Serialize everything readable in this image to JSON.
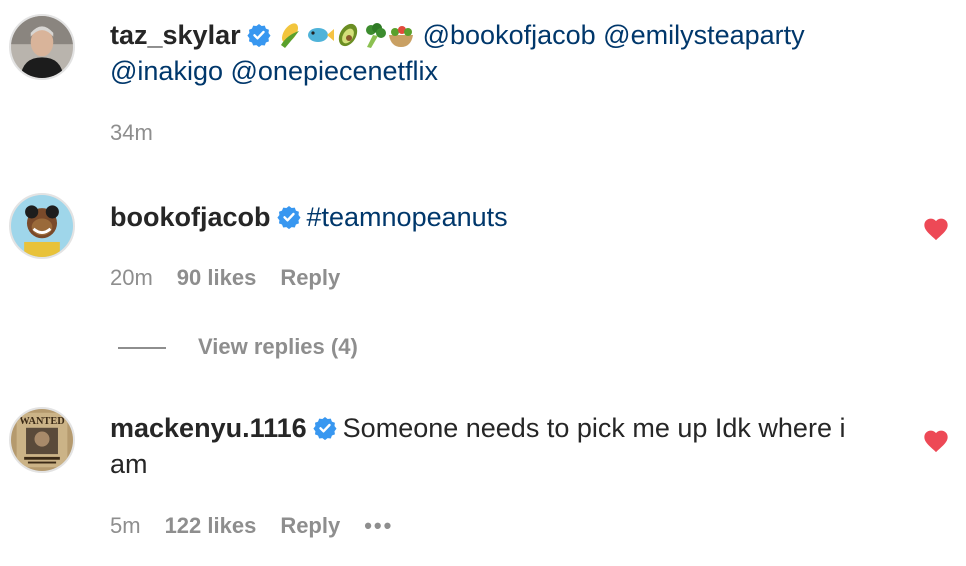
{
  "comments": [
    {
      "username": "taz_skylar",
      "verified": true,
      "emoji_icons": [
        "corn-emoji",
        "fish-emoji",
        "avocado-emoji",
        "broccoli-emoji",
        "salad-emoji"
      ],
      "mentions": [
        "@bookofjacob",
        "@emilysteaparty",
        "@inakigo",
        "@onepiecenetflix"
      ],
      "time": "34m"
    },
    {
      "username": "bookofjacob",
      "verified": true,
      "hashtag": "#teamnopeanuts",
      "time": "20m",
      "likes": "90 likes",
      "reply_label": "Reply",
      "liked": true,
      "view_replies": "View replies (4)"
    },
    {
      "username": "mackenyu.1116",
      "verified": true,
      "text_line1": "Someone needs to pick me up Idk where i",
      "text_line2": "am",
      "time": "5m",
      "likes": "122 likes",
      "reply_label": "Reply",
      "more": "•••",
      "liked": true,
      "avatar_text": "WANTED"
    }
  ],
  "colors": {
    "text": "#262626",
    "link": "#00376b",
    "meta": "#8e8e8e",
    "verified": "#3897f0",
    "heart": "#ed4956"
  }
}
